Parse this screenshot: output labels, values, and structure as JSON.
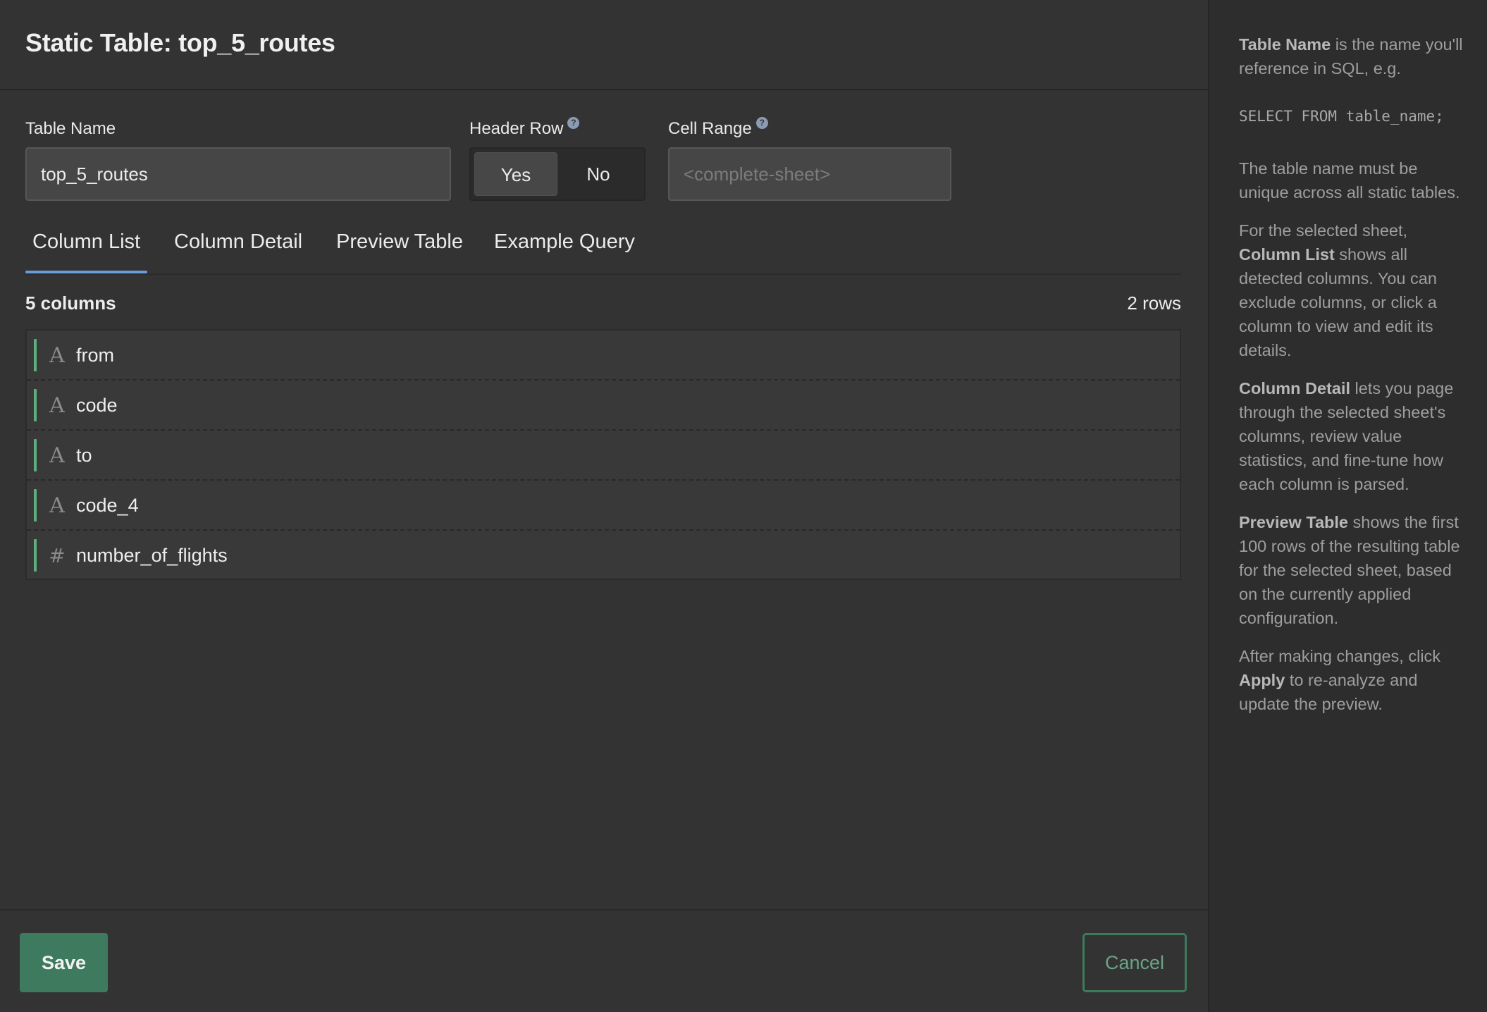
{
  "header": {
    "title": "Static Table: top_5_routes"
  },
  "form": {
    "table_name": {
      "label": "Table Name",
      "value": "top_5_routes"
    },
    "header_row": {
      "label": "Header Row",
      "options": [
        "Yes",
        "No"
      ],
      "selected": "Yes"
    },
    "cell_range": {
      "label": "Cell Range",
      "placeholder": "<complete-sheet>"
    }
  },
  "tabs": [
    {
      "label": "Column List",
      "active": true
    },
    {
      "label": "Column Detail",
      "active": false
    },
    {
      "label": "Preview Table",
      "active": false
    },
    {
      "label": "Example Query",
      "active": false
    }
  ],
  "summary": {
    "columns": "5 columns",
    "rows": "2 rows"
  },
  "columns": [
    {
      "name": "from",
      "type_icon": "A"
    },
    {
      "name": "code",
      "type_icon": "A"
    },
    {
      "name": "to",
      "type_icon": "A"
    },
    {
      "name": "code_4",
      "type_icon": "A"
    },
    {
      "name": "number_of_flights",
      "type_icon": "#"
    }
  ],
  "footer": {
    "save_label": "Save",
    "cancel_label": "Cancel"
  },
  "help": {
    "p1_bold": "Table Name",
    "p1_text": " is the name you'll reference in SQL, e.g.",
    "code": "SELECT FROM table_name;",
    "p2": "The table name must be unique across all static tables.",
    "p3_pre": "For the selected sheet, ",
    "p3_bold": "Column List",
    "p3_text": " shows all detected columns. You can exclude columns, or click a column to view and edit its details.",
    "p4_bold": "Column Detail",
    "p4_text": " lets you page through the selected sheet's columns, review value statistics, and fine-tune how each column is parsed.",
    "p5_bold": "Preview Table",
    "p5_text": " shows the first 100 rows of the resulting table for the selected sheet, based on the currently applied configuration.",
    "p6_pre": "After making changes, click ",
    "p6_bold": "Apply",
    "p6_text": " to re-analyze and update the preview."
  },
  "colors": {
    "accent_green": "#3e7a5e",
    "tab_underline": "#6d9bd8",
    "column_bar": "#5fae7e",
    "background": "#333333",
    "sidebar_background": "#2d2d2d"
  }
}
